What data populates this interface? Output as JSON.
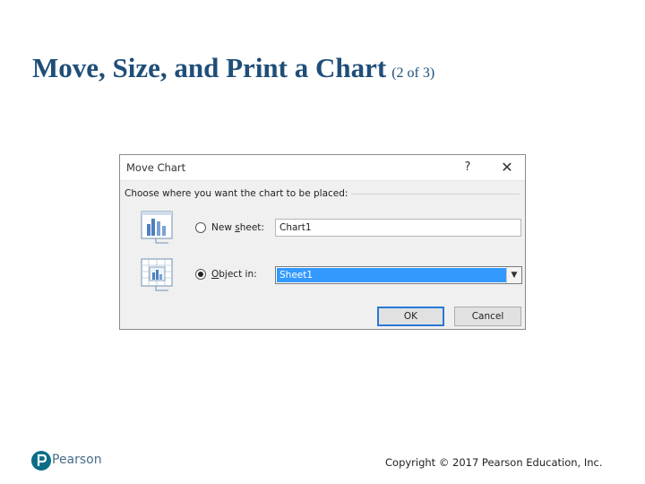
{
  "slide": {
    "title": "Move, Size, and Print a Chart",
    "subtitle": "(2 of 3)"
  },
  "dialog": {
    "title": "Move Chart",
    "help_label": "?",
    "close_label": "✕",
    "instruction": "Choose where you want the chart to be placed:",
    "new_sheet": {
      "label_pre": "New ",
      "label_underline": "s",
      "label_post": "heet:",
      "value": "Chart1",
      "selected": false,
      "icon": "chart-sheet-icon"
    },
    "object_in": {
      "label_underline": "O",
      "label_post": "bject in:",
      "value": "Sheet1",
      "selected": true,
      "icon": "embedded-chart-icon"
    },
    "ok_label": "OK",
    "cancel_label": "Cancel",
    "accent_color": "#3399ff"
  },
  "footer": {
    "brand": "Pearson",
    "copyright": "Copyright © 2017 Pearson Education, Inc."
  }
}
